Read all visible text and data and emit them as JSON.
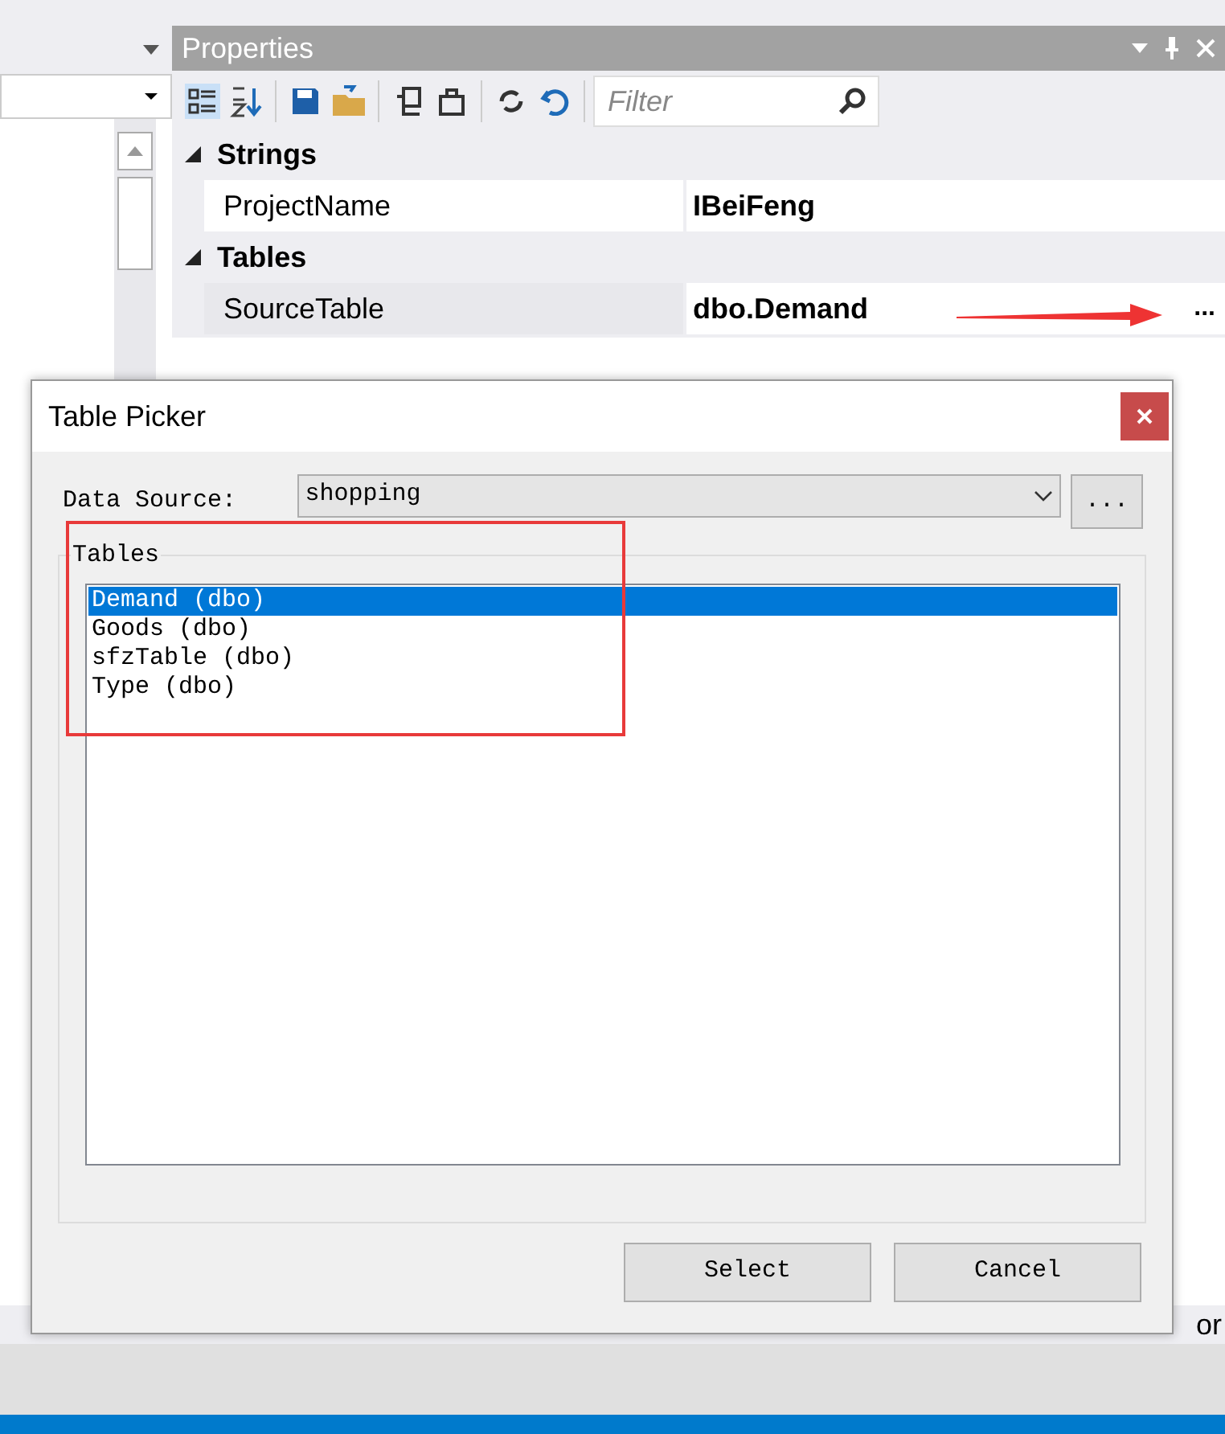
{
  "properties_panel": {
    "title": "Properties",
    "filter": {
      "placeholder": "Filter"
    },
    "categories": [
      {
        "name": "Strings",
        "expanded": true,
        "rows": [
          {
            "name": "ProjectName",
            "value": "IBeiFeng",
            "selected": false
          }
        ]
      },
      {
        "name": "Tables",
        "expanded": true,
        "rows": [
          {
            "name": "SourceTable",
            "value": "dbo.Demand",
            "selected": true,
            "button": "..."
          }
        ]
      }
    ]
  },
  "background_fragment": "or",
  "dialog": {
    "title": "Table Picker",
    "data_source": {
      "label": "Data Source:",
      "value": "shopping",
      "browse_button": "..."
    },
    "tables_group": {
      "label": "Tables",
      "items": [
        {
          "label": "Demand (dbo)",
          "selected": true
        },
        {
          "label": "Goods (dbo)",
          "selected": false
        },
        {
          "label": "sfzTable (dbo)",
          "selected": false
        },
        {
          "label": "Type (dbo)",
          "selected": false
        }
      ]
    },
    "buttons": [
      "Select",
      "Cancel"
    ]
  }
}
